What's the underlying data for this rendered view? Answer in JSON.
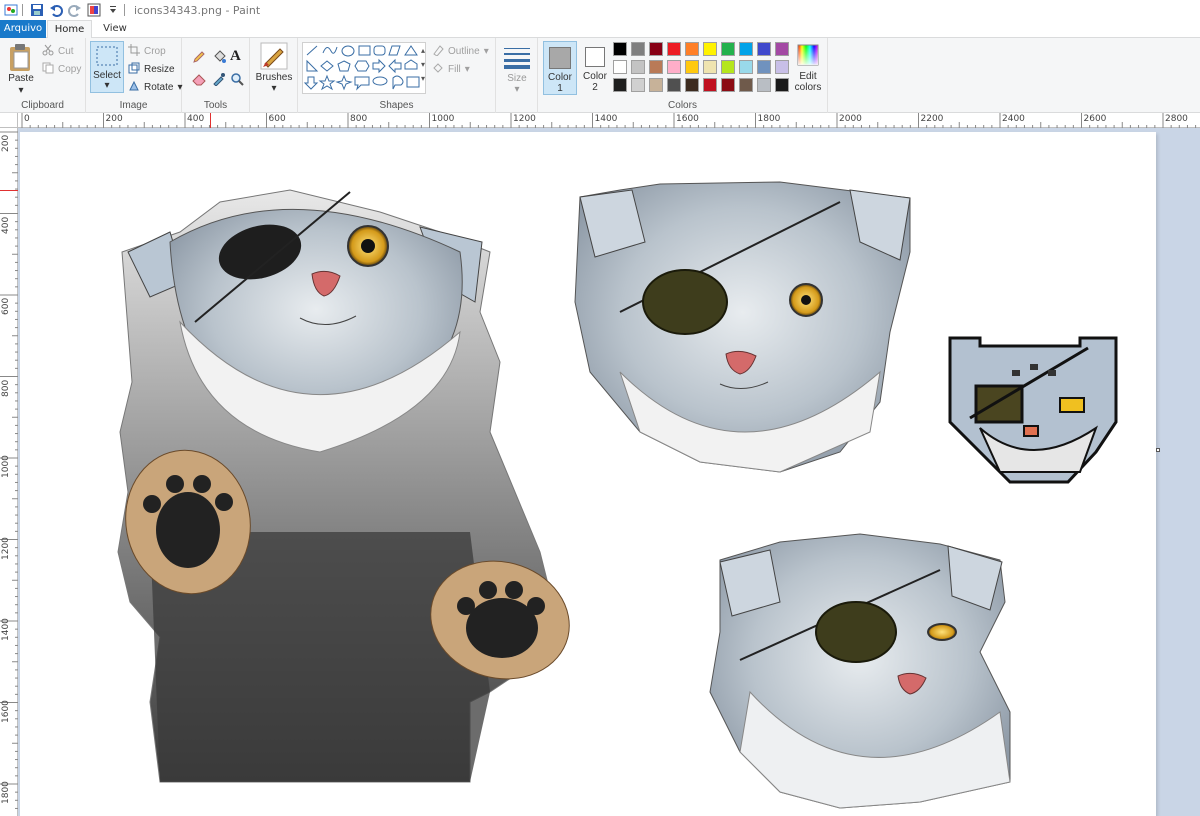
{
  "window": {
    "title": "icons34343.png - Paint"
  },
  "tabs": {
    "file": "Arquivo",
    "home": "Home",
    "view": "View"
  },
  "clipboard": {
    "paste": "Paste",
    "cut": "Cut",
    "copy": "Copy",
    "label": "Clipboard"
  },
  "image": {
    "select": "Select",
    "crop": "Crop",
    "resize": "Resize",
    "rotate": "Rotate",
    "label": "Image"
  },
  "tools": {
    "label": "Tools"
  },
  "brushes": {
    "label": "Brushes"
  },
  "shapes": {
    "outline": "Outline",
    "fill": "Fill",
    "label": "Shapes"
  },
  "size": {
    "label": "Size"
  },
  "colors": {
    "color1": "Color",
    "color1_num": "1",
    "color2": "Color",
    "color2_num": "2",
    "edit": "Edit",
    "edit2": "colors",
    "label": "Colors",
    "color1_value": "#a8a8a8",
    "color2_value": "#ffffff",
    "palette_row1": [
      "#000000",
      "#7f7f7f",
      "#880015",
      "#ed1c24",
      "#ff7f27",
      "#fff200",
      "#22b14c",
      "#00a2e8",
      "#3f48cc",
      "#a349a4"
    ],
    "palette_row2": [
      "#ffffff",
      "#c3c3c3",
      "#b97a57",
      "#ffaec9",
      "#ffc90e",
      "#efe4b0",
      "#b5e61d",
      "#99d9ea",
      "#7092be",
      "#c8bfe7"
    ],
    "palette_row3": [
      "#1e1e1e",
      "#d0d0d0",
      "#c7b299",
      "#505050",
      "#3d2b1f",
      "#c01020",
      "#8b0c14",
      "#6f5a4b",
      "#b9bec4",
      "#1a1a1a"
    ]
  },
  "ruler": {
    "top_labels": [
      "0",
      "200",
      "400",
      "600",
      "800",
      "1000",
      "1200",
      "1400",
      "1600",
      "1800",
      "2000",
      "2200",
      "2400",
      "2600",
      "2800"
    ],
    "left_labels": [
      "200",
      "400",
      "600",
      "800",
      "1000",
      "1200",
      "1400",
      "1600",
      "1800"
    ]
  },
  "canvas_content": [
    "large-cat-with-paws-artwork",
    "cat-head-eyepatch-artwork",
    "pixel-cat-head-artwork",
    "cat-head-eyepatch-small-artwork"
  ]
}
